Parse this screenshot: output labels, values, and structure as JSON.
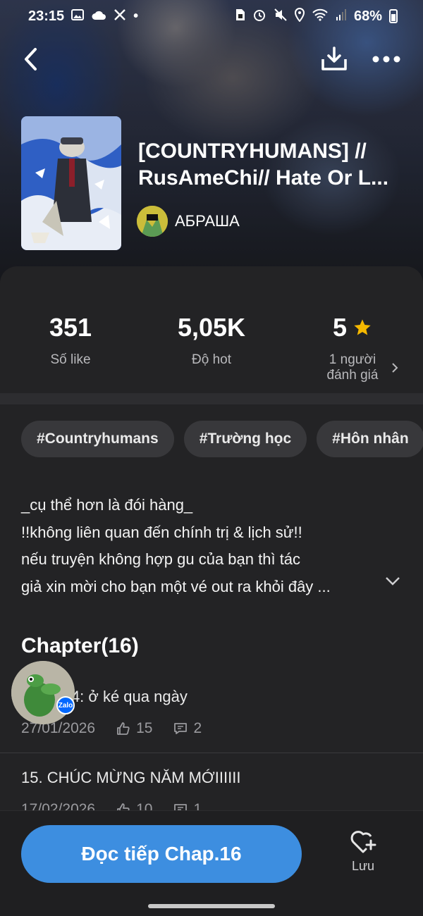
{
  "status_bar": {
    "time": "23:15",
    "dot": "•",
    "battery": "68%"
  },
  "book": {
    "title_line1": "[COUNTRYHUMANS] //",
    "title_line2": "RusAmeChi// Hate Or L...",
    "author": "АБРАША"
  },
  "stats": {
    "likes_value": "351",
    "likes_label": "Số like",
    "hot_value": "5,05K",
    "hot_label": "Độ hot",
    "rating_value": "5",
    "rating_label_line1": "1 người",
    "rating_label_line2": "đánh giá"
  },
  "tags": [
    "#Countryhumans",
    "#Trường học",
    "#Hôn nhân"
  ],
  "description": [
    "_cụ thể hơn là đói hàng_",
    "!!không liên quan đến chính trị & lịch sử!!",
    "nếu truyện không hợp gu của bạn thì tác",
    "giả xin mời cho bạn một vé out ra khỏi đây ..."
  ],
  "chapters": {
    "heading": "Chapter(16)",
    "items": [
      {
        "title": "Chap 14: ở ké qua ngày",
        "date": "27/01/2026",
        "likes": "15",
        "comments": "2"
      },
      {
        "title": "15. CHÚC MỪNG NĂM MỚIIIIII",
        "date": "17/02/2026",
        "likes": "10",
        "comments": "1"
      }
    ]
  },
  "bottom": {
    "read_button": "Đọc tiếp Chap.16",
    "save_label": "Lưu"
  },
  "zalo": {
    "badge": "Zalo"
  },
  "colors": {
    "accent": "#3d8ee0",
    "star": "#f5b800",
    "panel": "#232325"
  }
}
